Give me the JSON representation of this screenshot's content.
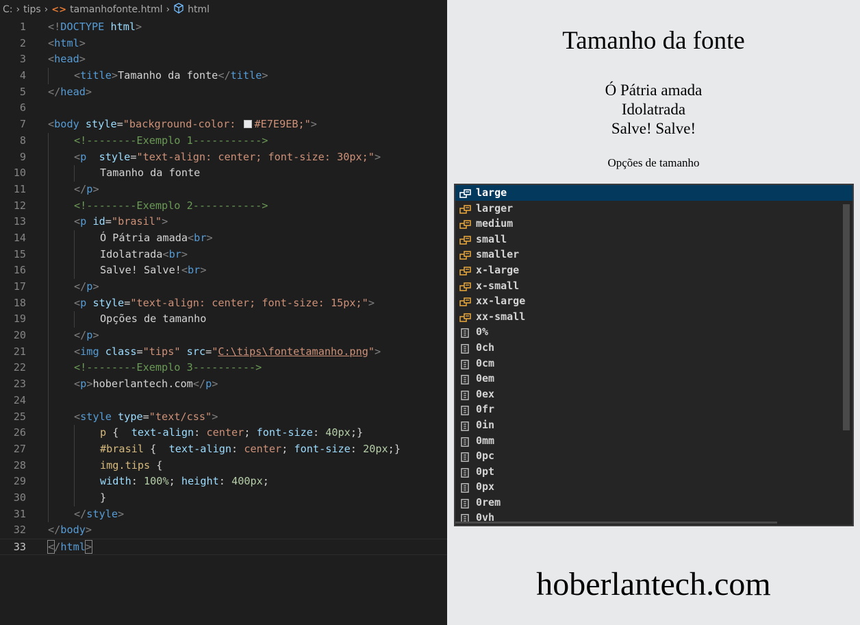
{
  "breadcrumb": {
    "drive": "C:",
    "folder": "tips",
    "file": "tamanhofonte.html",
    "node": "html"
  },
  "code_lines": [
    {
      "n": "1"
    },
    {
      "n": "2"
    },
    {
      "n": "3"
    },
    {
      "n": "4"
    },
    {
      "n": "5"
    },
    {
      "n": "6"
    },
    {
      "n": "7"
    },
    {
      "n": "8"
    },
    {
      "n": "9"
    },
    {
      "n": "10"
    },
    {
      "n": "11"
    },
    {
      "n": "12"
    },
    {
      "n": "13"
    },
    {
      "n": "14"
    },
    {
      "n": "15"
    },
    {
      "n": "16"
    },
    {
      "n": "17"
    },
    {
      "n": "18"
    },
    {
      "n": "19"
    },
    {
      "n": "20"
    },
    {
      "n": "21"
    },
    {
      "n": "22"
    },
    {
      "n": "23"
    },
    {
      "n": "24"
    },
    {
      "n": "25"
    },
    {
      "n": "26"
    },
    {
      "n": "27"
    },
    {
      "n": "28"
    },
    {
      "n": "29"
    },
    {
      "n": "30"
    },
    {
      "n": "31"
    },
    {
      "n": "32"
    },
    {
      "n": "33"
    }
  ],
  "code": {
    "l1_a": "<!",
    "l1_b": "DOCTYPE",
    "l1_c": " html",
    "l1_d": ">",
    "l2": "html",
    "l3": "head",
    "l4_tag": "title",
    "l4_text": "Tamanho da fonte",
    "l5": "head",
    "l7_tag": "body",
    "l7_attr": "style",
    "l7_val1": "\"background-color: ",
    "l7_val2": "#E7E9EB;\"",
    "l8": "<!--------Exemplo 1----------->",
    "l9_tag": "p",
    "l9_attr": "style",
    "l9_val": "\"text-align: center; font-size: 30px;\"",
    "l10": "Tamanho da fonte",
    "l11": "p",
    "l12": "<!--------Exemplo 2----------->",
    "l13_tag": "p",
    "l13_attr": "id",
    "l13_val": "\"brasil\"",
    "l14": "Ó Pátria amada",
    "l15": "Idolatrada",
    "l16": "Salve! Salve!",
    "br": "br",
    "l17": "p",
    "l18_tag": "p",
    "l18_attr": "style",
    "l18_val": "\"text-align: center; font-size: 15px;\"",
    "l19": "Opções de tamanho",
    "l20": "p",
    "l21_tag": "img",
    "l21_attr1": "class",
    "l21_val1": "\"tips\"",
    "l21_attr2": "src",
    "l21_val2a": "\"",
    "l21_val2b": "C:\\tips\\fontetamanho.png",
    "l21_val2c": "\"",
    "l22": "<!--------Exemplo 3---------->",
    "l23_tag": "p",
    "l23_text": "hoberlantech.com",
    "l25_tag": "style",
    "l25_attr": "type",
    "l25_val": "\"text/css\"",
    "l26_sel": "p",
    "l26_p1": "text-align",
    "l26_v1": "center",
    "l26_p2": "font-size",
    "l26_v2": "40px",
    "l27_sel": "#brasil",
    "l27_p1": "text-align",
    "l27_v1": "center",
    "l27_p2": "font-size",
    "l27_v2": "20px",
    "l28_sel": "img.tips",
    "l29_p1": "width",
    "l29_v1": "100%",
    "l29_p2": "height",
    "l29_v2": "400px",
    "l31": "style",
    "l32": "body",
    "l33": "html"
  },
  "preview": {
    "title": "Tamanho da fonte",
    "anthem": [
      "Ó Pátria amada",
      "Idolatrada",
      "Salve! Salve!"
    ],
    "options_caption": "Opções de tamanho",
    "site": "hoberlantech.com",
    "background": "#E7E9EB"
  },
  "suggestions": [
    {
      "label": "large",
      "icon": "keyword-icon"
    },
    {
      "label": "larger",
      "icon": "keyword-icon"
    },
    {
      "label": "medium",
      "icon": "keyword-icon"
    },
    {
      "label": "small",
      "icon": "keyword-icon"
    },
    {
      "label": "smaller",
      "icon": "keyword-icon"
    },
    {
      "label": "x-large",
      "icon": "keyword-icon"
    },
    {
      "label": "x-small",
      "icon": "keyword-icon"
    },
    {
      "label": "xx-large",
      "icon": "keyword-icon"
    },
    {
      "label": "xx-small",
      "icon": "keyword-icon"
    },
    {
      "label": "0%",
      "icon": "unit-icon"
    },
    {
      "label": "0ch",
      "icon": "unit-icon"
    },
    {
      "label": "0cm",
      "icon": "unit-icon"
    },
    {
      "label": "0em",
      "icon": "unit-icon"
    },
    {
      "label": "0ex",
      "icon": "unit-icon"
    },
    {
      "label": "0fr",
      "icon": "unit-icon"
    },
    {
      "label": "0in",
      "icon": "unit-icon"
    },
    {
      "label": "0mm",
      "icon": "unit-icon"
    },
    {
      "label": "0pc",
      "icon": "unit-icon"
    },
    {
      "label": "0pt",
      "icon": "unit-icon"
    },
    {
      "label": "0px",
      "icon": "unit-icon"
    },
    {
      "label": "0rem",
      "icon": "unit-icon"
    },
    {
      "label": "0vh",
      "icon": "unit-icon"
    }
  ],
  "colors": {
    "editor_bg": "#1e1e1e",
    "selected_suggestion": "#04395e",
    "keyword_icon": "#e2a33a"
  }
}
